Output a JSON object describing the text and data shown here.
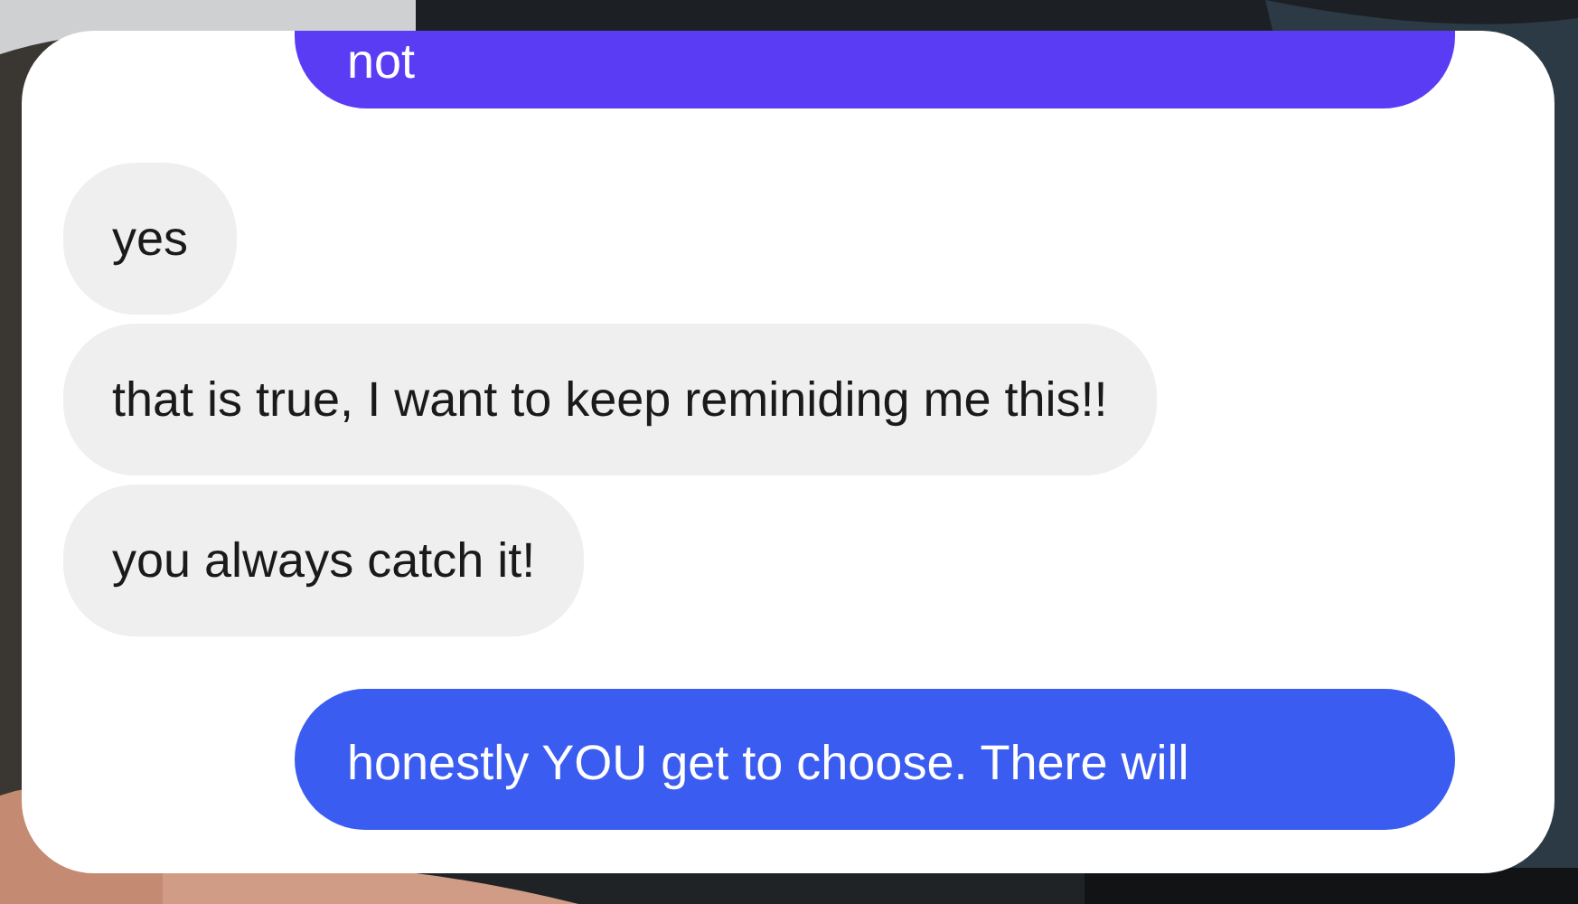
{
  "messages": [
    {
      "kind": "sent",
      "text": "not",
      "color": "#5a3cf4"
    },
    {
      "kind": "received",
      "text": "yes",
      "color": "#efefef"
    },
    {
      "kind": "received",
      "text": "that is true, I want to keep reminiding me this!!",
      "color": "#efefef"
    },
    {
      "kind": "received",
      "text": "you always catch it!",
      "color": "#efefef"
    },
    {
      "kind": "sent",
      "text": "honestly YOU get to choose. There will",
      "color": "#3b5cf1"
    }
  ]
}
